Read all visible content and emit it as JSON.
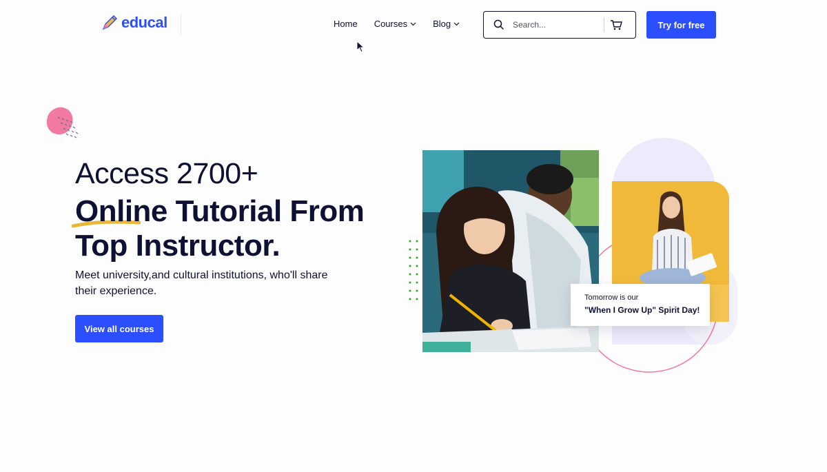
{
  "header": {
    "logo_text": "educal",
    "logo_icon": "pencil-icon",
    "nav": [
      {
        "label": "Home",
        "has_dropdown": false
      },
      {
        "label": "Courses",
        "has_dropdown": true
      },
      {
        "label": "Blog",
        "has_dropdown": true
      }
    ],
    "search": {
      "placeholder": "Search...",
      "icon": "search-icon",
      "cart_icon": "cart-icon"
    },
    "cta_label": "Try for free"
  },
  "hero": {
    "subtitle": "Access 2700+",
    "title": "Online Tutorial From Top Instructor.",
    "description": "Meet university,and cultural institutions, who'll share their experience.",
    "button_label": "View all courses"
  },
  "event_card": {
    "line1": "Tomorrow is our",
    "line2": "\"When I Grow Up\" Spirit Day!"
  },
  "colors": {
    "accent": "#2b4eff",
    "text": "#0e1133",
    "highlight": "#e7b83a",
    "pink": "#f279a0",
    "lavender": "#eceafb",
    "dots": "#30a820"
  }
}
